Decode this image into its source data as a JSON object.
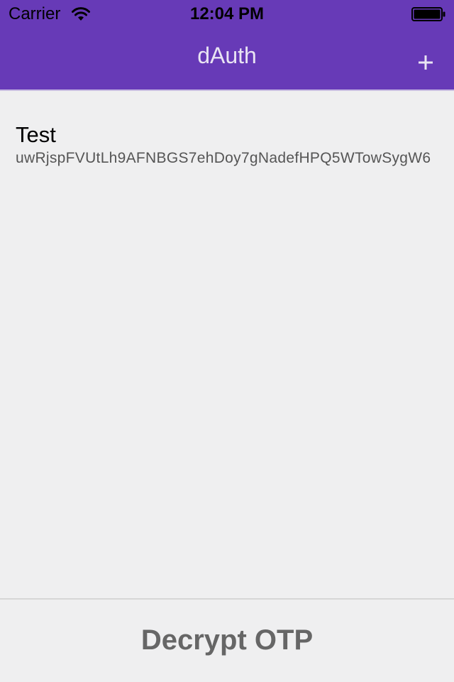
{
  "status_bar": {
    "carrier": "Carrier",
    "time": "12:04 PM",
    "wifi_icon": "wifi-icon",
    "battery_icon": "battery-icon"
  },
  "header": {
    "title": "dAuth",
    "add_icon": "plus-icon",
    "background_color": "#673ab7"
  },
  "accounts": [
    {
      "name": "Test",
      "key": "uwRjspFVUtLh9AFNBGS7ehDoy7gNadefHPQ5WTowSygW6"
    }
  ],
  "footer": {
    "decrypt_label": "Decrypt OTP"
  }
}
